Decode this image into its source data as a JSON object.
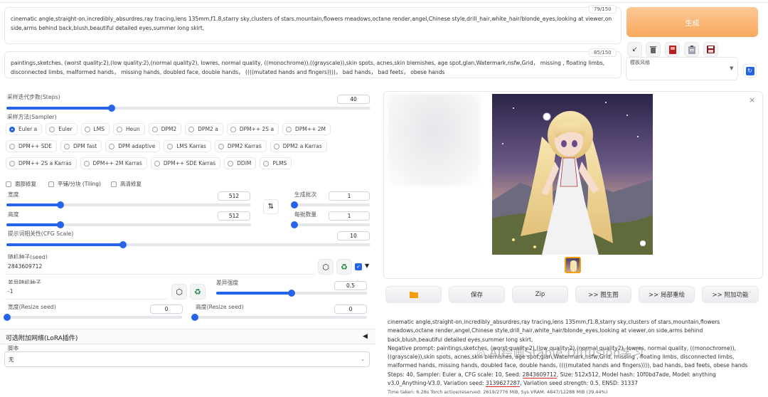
{
  "prompts": {
    "positive": {
      "text": "cinematic angle,straight-on,incredibly_absurdres,ray tracing,lens 135mm,f1.8,starry sky,clusters of stars,mountain,flowers meadows,octane render,angel,Chinese style,drill_hair,white_hair/blonde_eyes,looking at viewer,on side,arms behind back,blush,beautiful detailed eyes,summer long skirt,",
      "counter": "79/150"
    },
    "negative": {
      "text": "paintings,sketches, (worst quality:2),(low quality:2),(normal quality2), lowres, normal quality, ((monochrome)),((grayscale)),skin spots, acnes,skin blemishes, age spot,glan,Watermark,nsfw,Grid， missing , floating limbs, disconnected limbs, malformed hands， missing hands, doubled face, double hands， ((((mutated hands and fingers))))， bad hands， bad feets， obese hands",
      "counter": "85/150"
    }
  },
  "generate_button": "生成",
  "tool_icons": [
    "arrow-icon",
    "trash-icon",
    "card-icon",
    "clipboard-icon",
    "save-icon"
  ],
  "styles": {
    "label": "模板风格",
    "value": ""
  },
  "steps": {
    "label": "采样迭代步数(Steps)",
    "value": "40",
    "fraction": 0.29
  },
  "sampler": {
    "label": "采样方法(Sampler)",
    "options": [
      "Euler a",
      "Euler",
      "LMS",
      "Heun",
      "DPM2",
      "DPM2 a",
      "DPM++ 2S a",
      "DPM++ 2M",
      "DPM++ SDE",
      "DPM fast",
      "DPM adaptive",
      "LMS Karras",
      "DPM2 Karras",
      "DPM2 a Karras",
      "DPM++ 2S a Karras",
      "DPM++ 2M Karras",
      "DPM++ SDE Karras",
      "DDIM",
      "PLMS"
    ],
    "selected": "Euler a"
  },
  "checks": {
    "face_restore": "面部修复",
    "tiling": "平铺/分块 (Tiling)",
    "hires": "高清修复"
  },
  "width": {
    "label": "宽度",
    "value": "512",
    "fraction": 0.22
  },
  "height": {
    "label": "高度",
    "value": "512",
    "fraction": 0.22
  },
  "batch_count": {
    "label": "生成批次",
    "value": "1",
    "fraction": 0.0
  },
  "batch_size": {
    "label": "每批数量",
    "value": "1",
    "fraction": 0.0
  },
  "cfg": {
    "label": "提示词相关性(CFG Scale)",
    "value": "10",
    "fraction": 0.32
  },
  "seed": {
    "label": "随机种子(seed)",
    "value": "2843609712"
  },
  "var_seed": {
    "label": "差异随机种子",
    "value": "-1"
  },
  "var_strength": {
    "label": "差异强度",
    "value": "0.5",
    "fraction": 0.5
  },
  "resize_w": {
    "label": "宽度(Resize seed)",
    "value": "0",
    "fraction": 0.0
  },
  "resize_h": {
    "label": "高度(Resize seed)",
    "value": "0",
    "fraction": 0.0
  },
  "lora": {
    "label": "可选附加网络(LoRA插件)",
    "arrow": "◀"
  },
  "script": {
    "label": "脚本",
    "value": "无"
  },
  "actions": [
    "保存",
    "Zip",
    ">> 图生图",
    ">> 局部重绘",
    ">> 附加功能"
  ],
  "close": "×",
  "info": {
    "prompt": "cinematic angle,straight-on,incredibly_absurdres,ray tracing,lens 135mm,f1.8,starry sky,clusters of stars,mountain,flowers meadows,octane render,angel,Chinese style,drill_hair,white_hair/blonde_eyes,looking at viewer,on side,arms behind back,blush,beautiful detailed eyes,summer long skirt,",
    "negative": "Negative prompt: paintings,sketches, (worst quality:2),(low quality:2),(normal quality2), lowres, normal quality, ((monochrome)),((grayscale)),skin spots, acnes,skin blemishes, age spot,glan,Watermark,nsfw,Grid, missing , floating limbs, disconnected limbs, malformed hands, missing hands, doubled face, double hands, ((((mutated hands and fingers)))), bad hands, bad feets, obese hands",
    "params_a": "Steps: 40, Sampler: Euler a, CFG scale: 10, Seed: ",
    "seed": "2843609712",
    "params_b": ", Size: 512x512, Model hash: 10f0bd7ade, Model: anything v3.0_Anything-V3.0, Variation seed: ",
    "var_seed": "3139627287",
    "params_c": ", Variation seed strength: 0.5, ENSD: 31337",
    "time": "Time taken: 6.28s  Torch active/reserved: 2619/2776 MiB, Sys VRAM: 4847/12288 MiB (39.44%)"
  },
  "watermark": "AI绘画Stable Diffusion学习",
  "colors": {
    "accent": "#2563eb",
    "generate": "#fbbf80",
    "underline": "#dc2626"
  }
}
